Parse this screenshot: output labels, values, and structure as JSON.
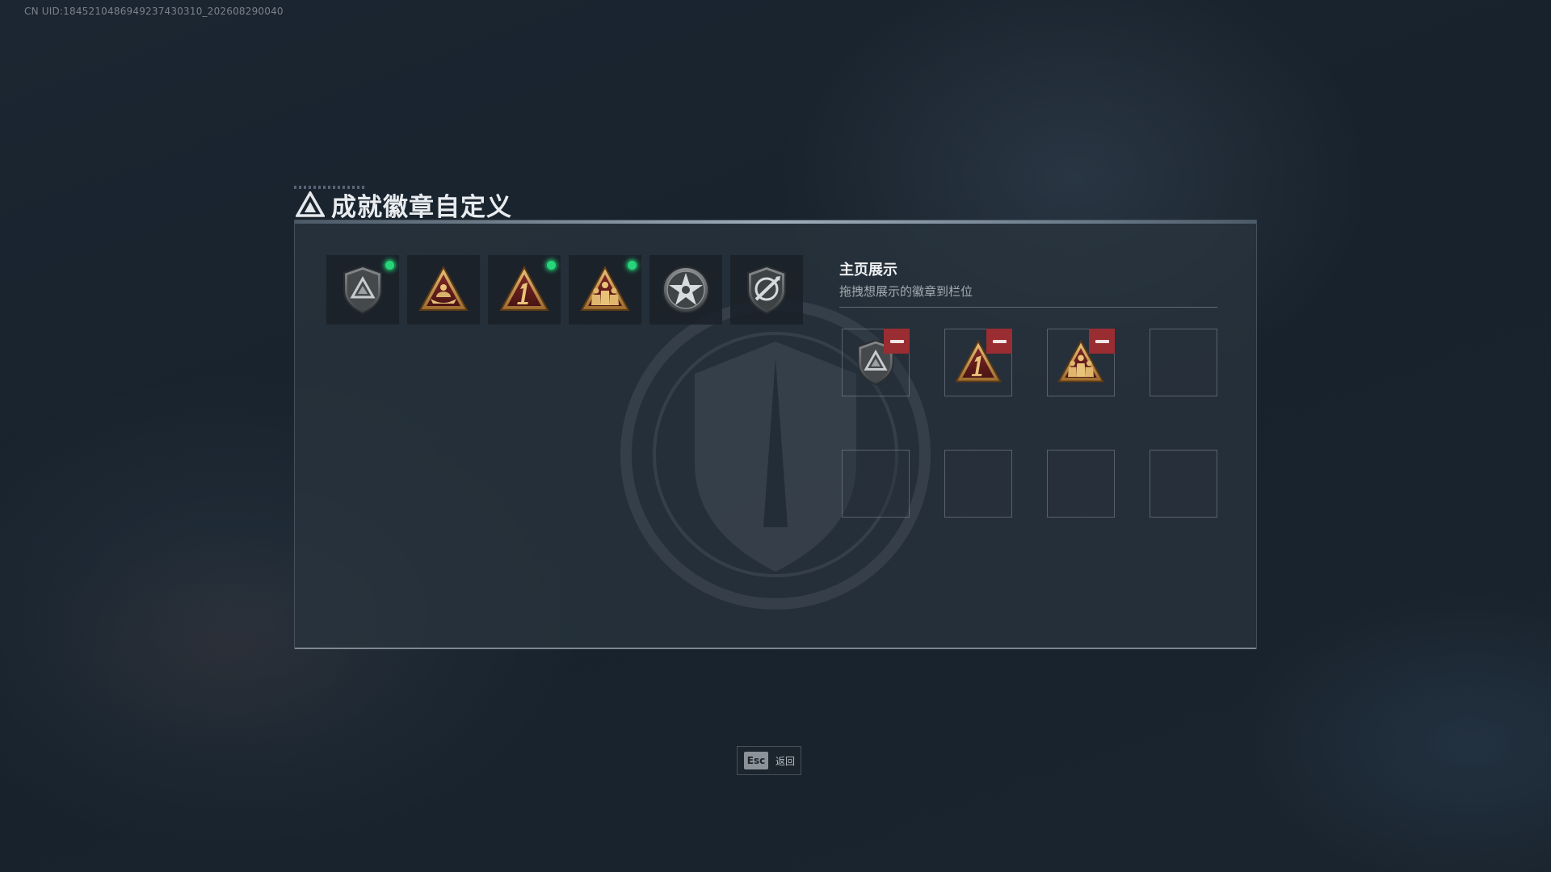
{
  "uid_text": "CN UID:1845210486949237430310_202608290040",
  "header": {
    "title": "成就徽章自定义",
    "icon": "triangle-emblem-icon"
  },
  "badge_list": [
    {
      "icon": "shield-triangle-badge-icon",
      "new": true
    },
    {
      "icon": "boat-triangle-badge-icon",
      "new": false
    },
    {
      "icon": "number-one-triangle-badge-icon",
      "new": true
    },
    {
      "icon": "soldiers-triangle-badge-icon",
      "new": true
    },
    {
      "icon": "star-medal-badge-icon",
      "new": false
    },
    {
      "icon": "crossed-target-shield-badge-icon",
      "new": false
    }
  ],
  "showcase": {
    "title": "主页展示",
    "subtitle": "拖拽想展示的徽章到栏位",
    "slots": [
      {
        "icon": "shield-triangle-badge-icon",
        "filled": true
      },
      {
        "icon": "number-one-triangle-badge-icon",
        "filled": true
      },
      {
        "icon": "soldiers-triangle-badge-icon",
        "filled": true
      },
      {
        "filled": false
      },
      {
        "filled": false
      },
      {
        "filled": false
      },
      {
        "filled": false
      },
      {
        "filled": false
      }
    ]
  },
  "footer": {
    "key": "Esc",
    "label": "返回"
  },
  "colors": {
    "accent_green": "#27d67c",
    "remove_red": "#9a2d31",
    "badge_gold": "#c89a4a"
  }
}
